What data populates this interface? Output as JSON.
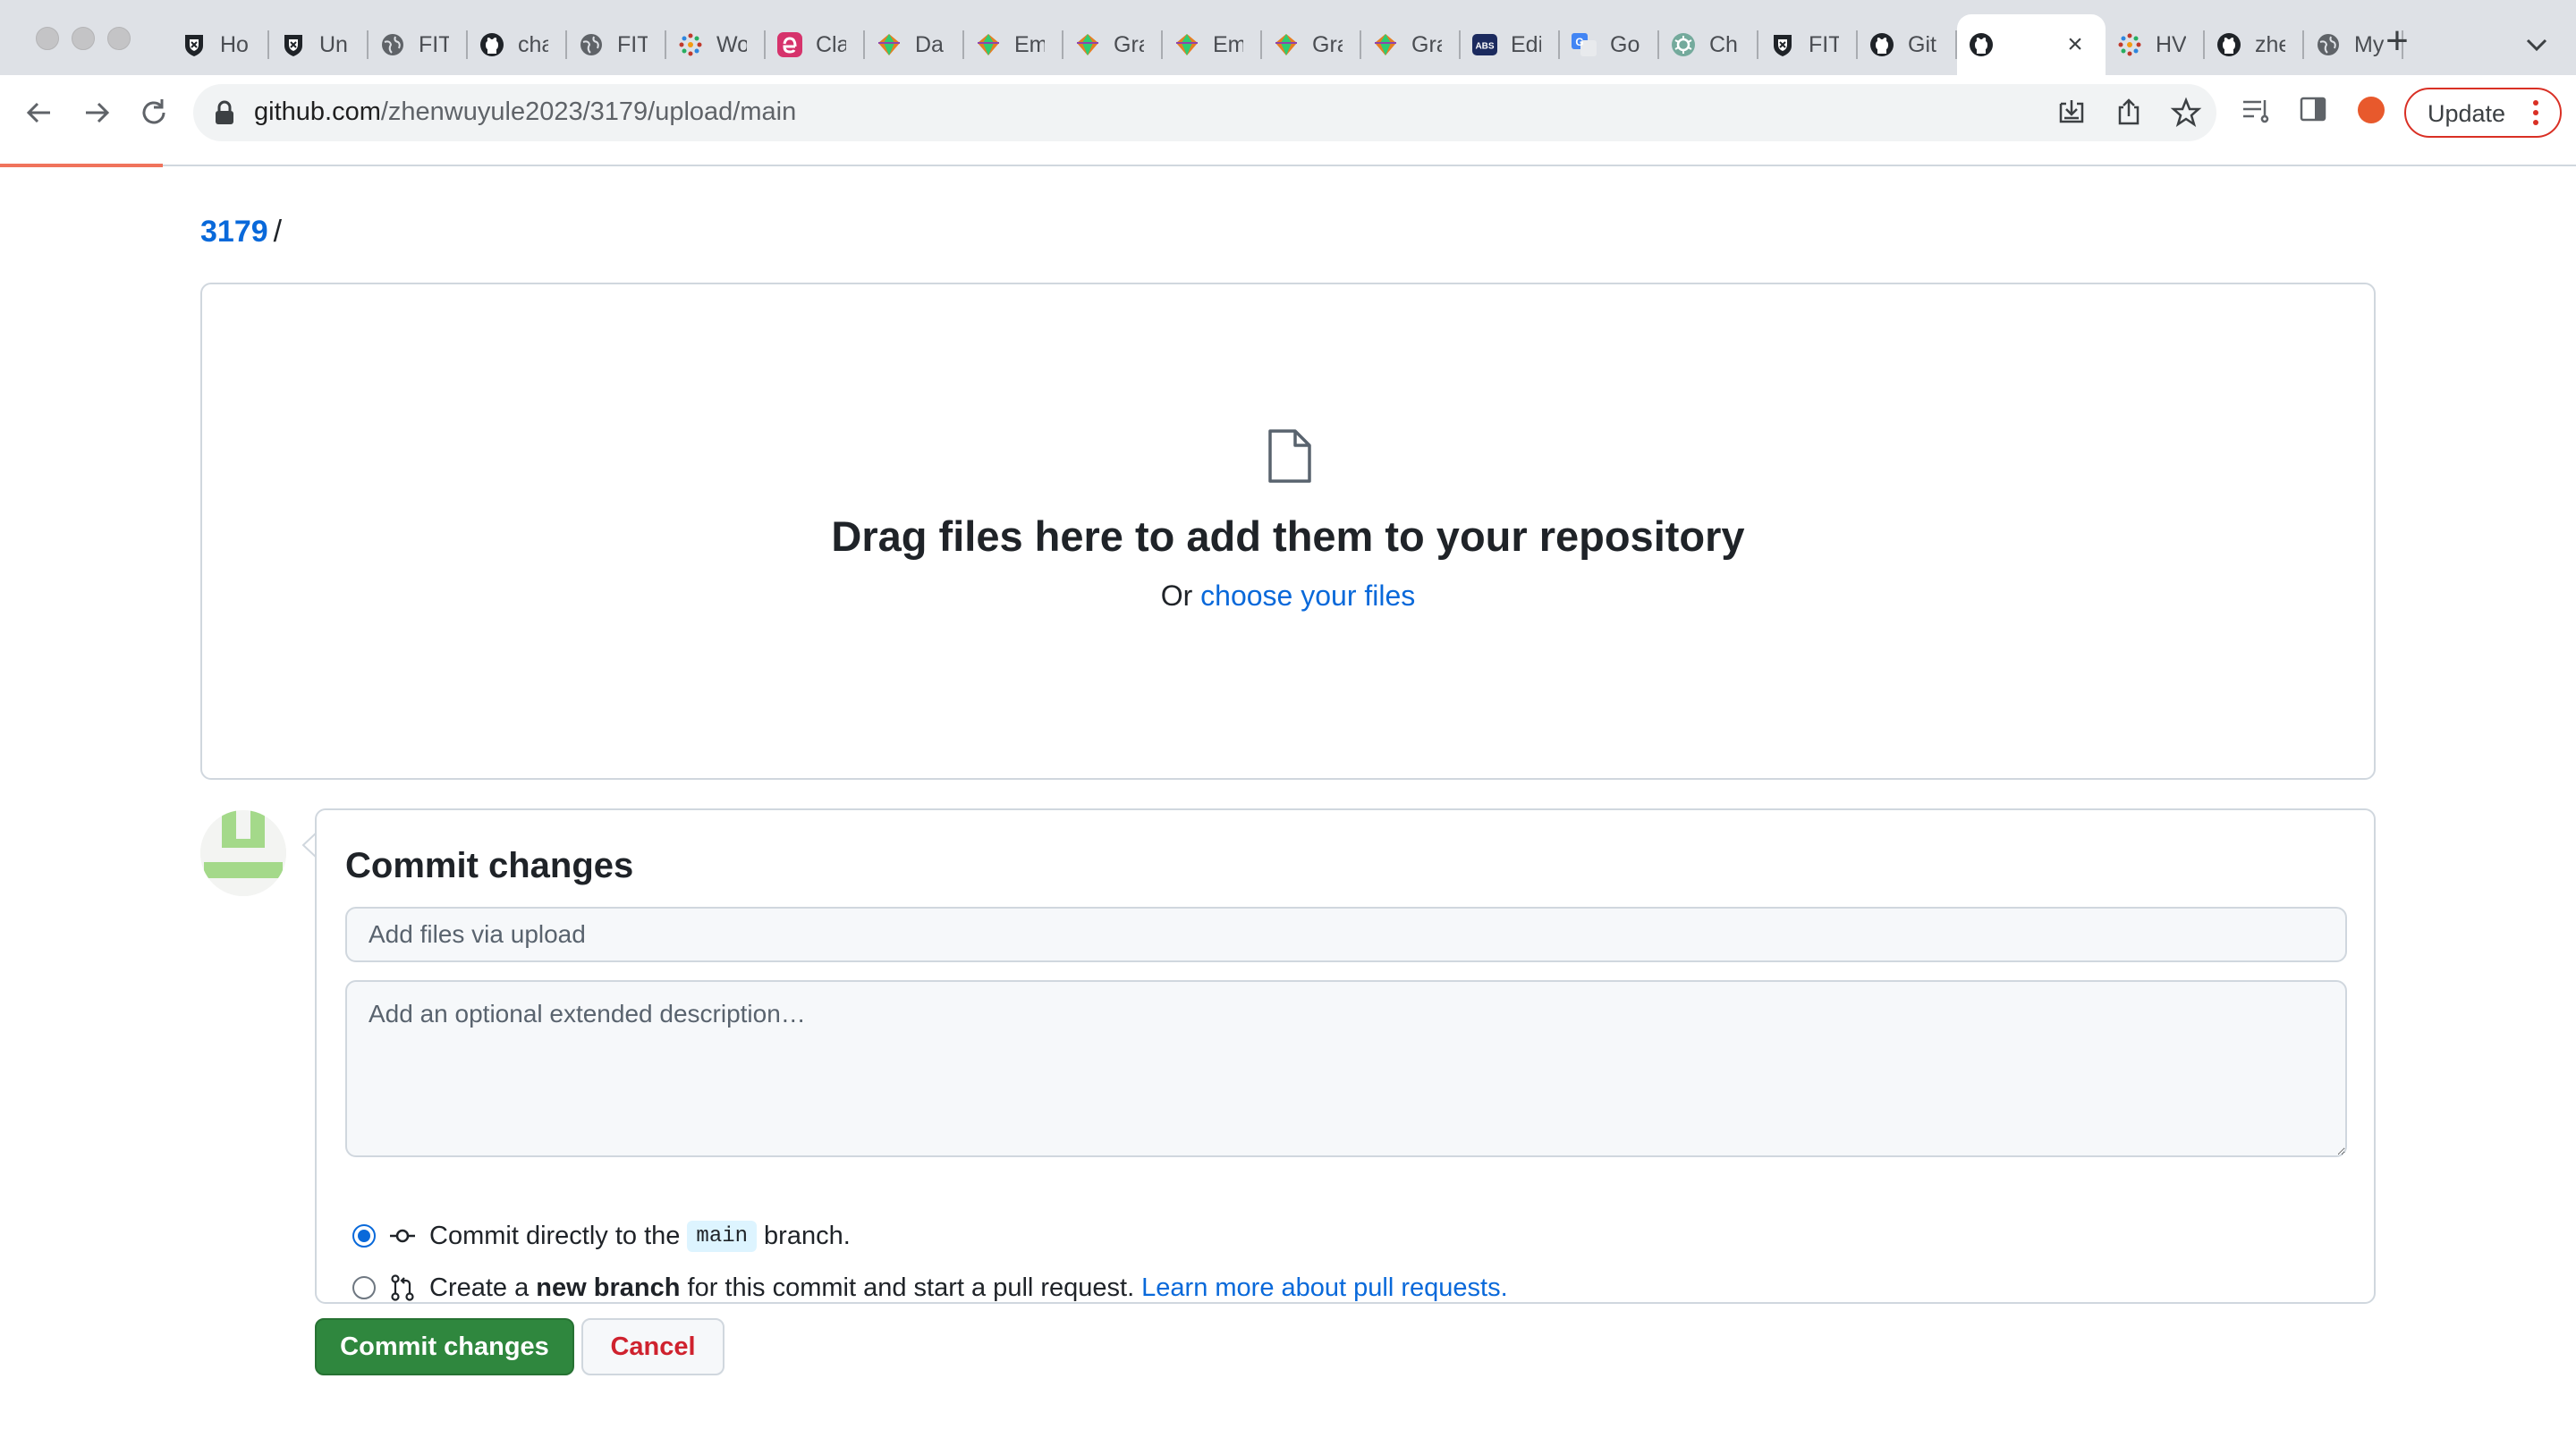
{
  "browser": {
    "tabs": [
      {
        "title": "Ho",
        "icon": "shield-favicon-icon"
      },
      {
        "title": "Un",
        "icon": "shield-favicon-icon"
      },
      {
        "title": "FIT",
        "icon": "globe-icon"
      },
      {
        "title": "cha",
        "icon": "github-icon"
      },
      {
        "title": "FIT",
        "icon": "globe-icon"
      },
      {
        "title": "Wo",
        "icon": "dots-favicon-icon"
      },
      {
        "title": "Cla",
        "icon": "e-favicon-icon"
      },
      {
        "title": "Da",
        "icon": "diamond-favicon-icon"
      },
      {
        "title": "Em",
        "icon": "diamond-favicon-icon"
      },
      {
        "title": "Gra",
        "icon": "diamond-favicon-icon"
      },
      {
        "title": "Em",
        "icon": "diamond-favicon-icon"
      },
      {
        "title": "Gra",
        "icon": "diamond-favicon-icon"
      },
      {
        "title": "Gra",
        "icon": "diamond-favicon-icon"
      },
      {
        "title": "Edi",
        "icon": "abs-favicon-icon",
        "badge": "ABS"
      },
      {
        "title": "Go",
        "icon": "translate-favicon-icon"
      },
      {
        "title": "Ch",
        "icon": "openai-favicon-icon"
      },
      {
        "title": "FIT",
        "icon": "shield-favicon-icon"
      },
      {
        "title": "Git",
        "icon": "github-icon"
      },
      {
        "title": "",
        "icon": "github-icon",
        "active": true
      },
      {
        "title": "HV",
        "icon": "dots-favicon-icon"
      },
      {
        "title": "zhe",
        "icon": "github-icon"
      },
      {
        "title": "My",
        "icon": "globe-icon"
      }
    ],
    "active_tab_close": "×",
    "new_tab": "+",
    "url_host": "github.com",
    "url_path": "/zhenwuyule2023/3179/upload/main",
    "update_label": "Update",
    "colors": {
      "accent_red": "#d93025",
      "progress": "#f0735c"
    }
  },
  "breadcrumb": {
    "repo": "3179",
    "separator": "/"
  },
  "dropzone": {
    "title": "Drag files here to add them to your repository",
    "sub_prefix": "Or",
    "choose_link": "choose your files"
  },
  "commit": {
    "heading": "Commit changes",
    "summary_placeholder": "Add files via upload",
    "description_placeholder": "Add an optional extended description…",
    "option_direct": {
      "prefix": "Commit directly to the",
      "branch": "main",
      "suffix": "branch.",
      "checked": true
    },
    "option_new": {
      "prefix": "Create a",
      "strong": "new branch",
      "suffix": "for this commit and start a pull request.",
      "link": "Learn more about pull requests.",
      "checked": false
    },
    "submit_label": "Commit changes",
    "cancel_label": "Cancel",
    "colors": {
      "submit": "#2f873e",
      "link": "#0969da",
      "cancel_text": "#cf222e"
    }
  }
}
